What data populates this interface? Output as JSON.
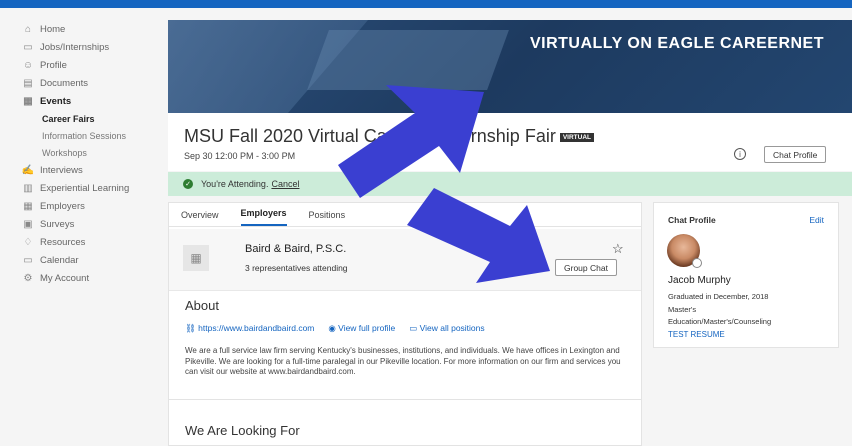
{
  "nav": {
    "items": [
      {
        "label": "Home",
        "icon": "home-icon"
      },
      {
        "label": "Jobs/Internships",
        "icon": "briefcase-icon"
      },
      {
        "label": "Profile",
        "icon": "person-icon"
      },
      {
        "label": "Documents",
        "icon": "document-icon"
      },
      {
        "label": "Events",
        "icon": "calendar-icon"
      },
      {
        "label": "Career Fairs"
      },
      {
        "label": "Information Sessions"
      },
      {
        "label": "Workshops"
      },
      {
        "label": "Interviews",
        "icon": "handshake-icon"
      },
      {
        "label": "Experiential Learning",
        "icon": "learning-icon"
      },
      {
        "label": "Employers",
        "icon": "building-icon"
      },
      {
        "label": "Surveys",
        "icon": "clipboard-icon"
      },
      {
        "label": "Resources",
        "icon": "pin-icon"
      },
      {
        "label": "Calendar",
        "icon": "calendar-icon"
      },
      {
        "label": "My Account",
        "icon": "gear-icon"
      }
    ]
  },
  "banner": {
    "title": "VIRTUALLY ON EAGLE CAREERNET"
  },
  "fair": {
    "title": "MSU Fall 2020 Virtual Career & Internship Fair",
    "badge": "VIRTUAL",
    "date": "Sep 30 12:00 PM - 3:00 PM",
    "chat_profile_button": "Chat Profile"
  },
  "attending": {
    "text": "You're Attending.",
    "cancel": "Cancel"
  },
  "tabs": [
    "Overview",
    "Employers",
    "Positions"
  ],
  "employer": {
    "name": "Baird & Baird, P.S.C.",
    "reps": "3 representatives attending",
    "group_chat": "Group Chat"
  },
  "about": {
    "title": "About",
    "website": "https://www.bairdandbaird.com",
    "view_profile": "View full profile",
    "view_positions": "View all positions",
    "description": "We are a full service law firm serving Kentucky's businesses, institutions, and individuals.  We have offices in Lexington and Pikeville.  We are looking for a full-time paralegal in our Pikeville location.  For more information on our firm and services you can visit our website at www.bairdandbaird.com."
  },
  "looking_for": {
    "title": "We Are Looking For"
  },
  "chat_profile": {
    "title": "Chat Profile",
    "edit": "Edit",
    "name": "Jacob Murphy",
    "graduated": "Graduated in December, 2018",
    "degree": "Master's",
    "major": "Education/Master's/Counseling",
    "resume": "TEST RESUME"
  },
  "colors": {
    "accent": "#1565c0",
    "arrow": "#3a3fd1",
    "attending_bg": "#ccecd9"
  }
}
